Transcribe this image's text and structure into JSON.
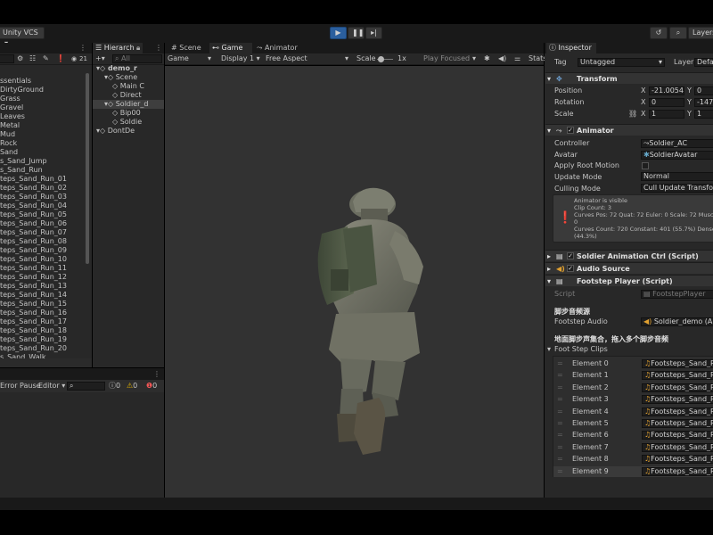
{
  "toolbar": {
    "vcs_label": "Unity VCS",
    "layers_label": "Layers"
  },
  "project": {
    "items": [
      "ssentials",
      "DirtyGround",
      "Grass",
      "Gravel",
      "Leaves",
      "Metal",
      "Mud",
      "Rock",
      "Sand",
      "s_Sand_Jump",
      "s_Sand_Run",
      "teps_Sand_Run_01",
      "teps_Sand_Run_02",
      "teps_Sand_Run_03",
      "teps_Sand_Run_04",
      "teps_Sand_Run_05",
      "teps_Sand_Run_06",
      "teps_Sand_Run_07",
      "teps_Sand_Run_08",
      "teps_Sand_Run_09",
      "teps_Sand_Run_10",
      "teps_Sand_Run_11",
      "teps_Sand_Run_12",
      "teps_Sand_Run_13",
      "teps_Sand_Run_14",
      "teps_Sand_Run_15",
      "teps_Sand_Run_16",
      "teps_Sand_Run_17",
      "teps_Sand_Run_18",
      "teps_Sand_Run_19",
      "teps_Sand_Run_20",
      "s_Sand_Walk"
    ],
    "count_badge": "21"
  },
  "hierarchy": {
    "tab": "Hierarch",
    "search_placeholder": "All",
    "items": [
      {
        "label": "demo_r",
        "indent": 0,
        "bold": true
      },
      {
        "label": "Scene",
        "indent": 1
      },
      {
        "label": "Main C",
        "indent": 2
      },
      {
        "label": "Direct",
        "indent": 2
      },
      {
        "label": "Soldier_d",
        "indent": 1,
        "selected": true
      },
      {
        "label": "Bip00",
        "indent": 2
      },
      {
        "label": "Soldie",
        "indent": 2
      },
      {
        "label": "DontDe",
        "indent": 0
      }
    ]
  },
  "console": {
    "error_pause": "Error Pause",
    "editor": "Editor",
    "counts": [
      "0",
      "0",
      "0"
    ]
  },
  "tabs": {
    "scene": "Scene",
    "game": "Game",
    "animator": "Animator"
  },
  "game_toolbar": {
    "display_mode": "Game",
    "display": "Display 1",
    "aspect": "Free Aspect",
    "scale_label": "Scale",
    "scale_value": "1x",
    "play_focused": "Play Focused",
    "stats": "Stats"
  },
  "inspector": {
    "tab": "Inspector",
    "tag_label": "Tag",
    "tag_value": "Untagged",
    "layer_label": "Layer",
    "layer_value": "Defau",
    "transform": {
      "title": "Transform",
      "position_label": "Position",
      "rotation_label": "Rotation",
      "scale_label": "Scale",
      "position": {
        "x": "-21.0054",
        "y": "0"
      },
      "rotation": {
        "x": "0",
        "y": "-147."
      },
      "scale": {
        "x": "1",
        "y": "1"
      }
    },
    "animator": {
      "title": "Animator",
      "controller_label": "Controller",
      "controller_value": "Soldier_AC",
      "avatar_label": "Avatar",
      "avatar_value": "SoldierAvatar",
      "apply_root_label": "Apply Root Motion",
      "update_mode_label": "Update Mode",
      "update_mode_value": "Normal",
      "culling_label": "Culling Mode",
      "culling_value": "Cull Update Transfor",
      "info_lines": [
        "Animator is visible",
        "Clip Count: 3",
        "Curves Pos: 72 Quat: 72 Euler: 0 Scale: 72 Muscles",
        "0",
        "Curves Count: 720 Constant: 401 (55.7%) Dense:",
        "(44.3%)"
      ]
    },
    "anim_ctrl": {
      "title": "Soldier Animation Ctrl (Script)"
    },
    "audio_source": {
      "title": "Audio Source"
    },
    "footstep": {
      "title": "Footstep Player (Script)",
      "script_label": "Script",
      "script_value": "FootstepPlayer",
      "section1": "脚步音频源",
      "footstep_audio_label": "Footstep Audio",
      "footstep_audio_value": "Soldier_demo (Audi",
      "section2": "地面脚步声集合，拖入多个脚步音频",
      "clips_label": "Foot Step Clips",
      "elements": [
        {
          "label": "Element 0",
          "value": "Footsteps_Sand_Run"
        },
        {
          "label": "Element 1",
          "value": "Footsteps_Sand_Run"
        },
        {
          "label": "Element 2",
          "value": "Footsteps_Sand_Run"
        },
        {
          "label": "Element 3",
          "value": "Footsteps_Sand_Run"
        },
        {
          "label": "Element 4",
          "value": "Footsteps_Sand_Run"
        },
        {
          "label": "Element 5",
          "value": "Footsteps_Sand_Run"
        },
        {
          "label": "Element 6",
          "value": "Footsteps_Sand_Run"
        },
        {
          "label": "Element 7",
          "value": "Footsteps_Sand_Run"
        },
        {
          "label": "Element 8",
          "value": "Footsteps_Sand_Run"
        },
        {
          "label": "Element 9",
          "value": "Footsteps_Sand_Run"
        }
      ]
    }
  }
}
